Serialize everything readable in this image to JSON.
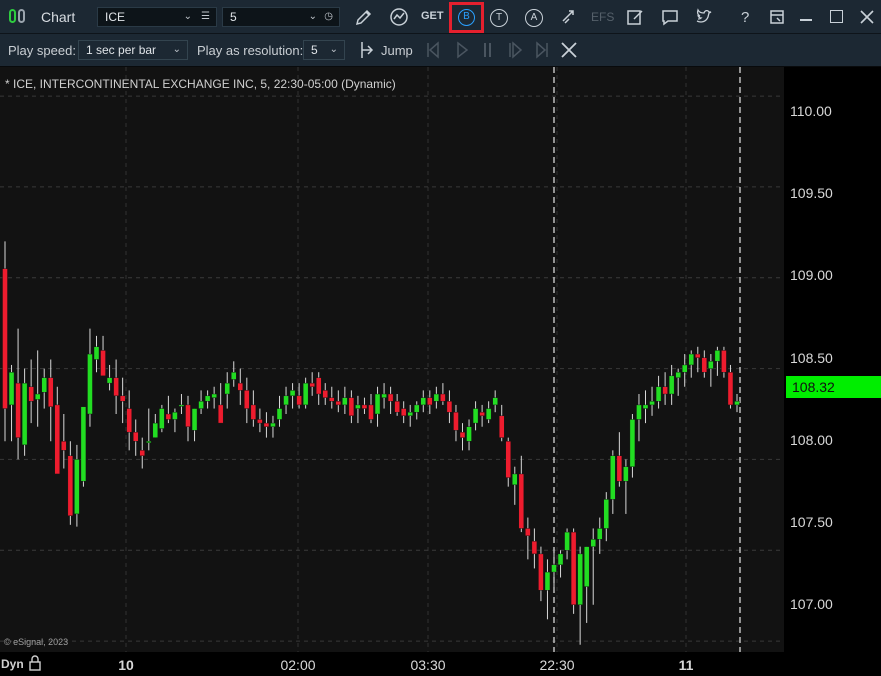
{
  "window": {
    "title": "Chart",
    "symbol": "ICE",
    "interval": "5",
    "get_label": "GET",
    "efs_label": "EFS"
  },
  "playback": {
    "speed_label": "Play speed:",
    "speed_value": "1 sec per bar",
    "resolution_label": "Play as resolution:",
    "resolution_value": "5",
    "jump_label": "Jump"
  },
  "chart": {
    "header": "* ICE, INTERCONTINENTAL EXCHANGE INC, 5, 22:30-05:00 (Dynamic)",
    "copyright": "© eSignal, 2023",
    "dyn_label": "Dyn",
    "last_price": "108.32"
  },
  "colors": {
    "up": "#22dd22",
    "down": "#ee1c2e",
    "last_price_bg": "#00ee00",
    "highlight": "#e5202e"
  },
  "y_axis": {
    "labels": [
      "110.00",
      "109.50",
      "109.00",
      "108.50",
      "108.00",
      "107.50",
      "107.00"
    ]
  },
  "x_axis": {
    "labels": [
      "10",
      "02:00",
      "03:30",
      "22:30",
      "11"
    ]
  },
  "chart_data": {
    "type": "candlestick",
    "title": "* ICE, INTERCONTINENTAL EXCHANGE INC, 5, 22:30-05:00 (Dynamic)",
    "ylim": [
      106.94,
      110.16
    ],
    "candles": [
      [
        109.05,
        109.2,
        108.1,
        108.28
      ],
      [
        108.3,
        108.52,
        108.1,
        108.48
      ],
      [
        108.42,
        108.72,
        108.0,
        108.12
      ],
      [
        108.08,
        108.5,
        108.02,
        108.42
      ],
      [
        108.4,
        108.55,
        108.2,
        108.32
      ],
      [
        108.33,
        108.6,
        108.18,
        108.36
      ],
      [
        108.37,
        108.5,
        108.28,
        108.45
      ],
      [
        108.45,
        108.55,
        108.1,
        108.29
      ],
      [
        108.3,
        108.4,
        107.95,
        107.92
      ],
      [
        108.1,
        108.25,
        107.95,
        108.05
      ],
      [
        108.02,
        108.1,
        107.64,
        107.69
      ],
      [
        107.7,
        108.08,
        107.63,
        108.0
      ],
      [
        107.88,
        108.28,
        107.85,
        108.29
      ],
      [
        108.25,
        108.72,
        108.18,
        108.58
      ],
      [
        108.55,
        108.68,
        108.48,
        108.62
      ],
      [
        108.6,
        108.68,
        108.48,
        108.46
      ],
      [
        108.42,
        108.52,
        108.38,
        108.45
      ],
      [
        108.45,
        108.55,
        108.25,
        108.35
      ],
      [
        108.35,
        108.45,
        108.2,
        108.32
      ],
      [
        108.28,
        108.38,
        108.05,
        108.15
      ],
      [
        108.15,
        108.22,
        108.02,
        108.1
      ],
      [
        108.05,
        108.12,
        107.95,
        108.02
      ],
      [
        108.1,
        108.28,
        108.05,
        108.1
      ],
      [
        108.12,
        108.25,
        108.12,
        108.2
      ],
      [
        108.17,
        108.3,
        108.15,
        108.28
      ],
      [
        108.25,
        108.35,
        108.2,
        108.22
      ],
      [
        108.22,
        108.28,
        108.15,
        108.26
      ],
      [
        108.3,
        108.36,
        108.25,
        108.3
      ],
      [
        108.3,
        108.35,
        108.1,
        108.18
      ],
      [
        108.16,
        108.28,
        108.1,
        108.28
      ],
      [
        108.28,
        108.38,
        108.25,
        108.32
      ],
      [
        108.32,
        108.38,
        108.28,
        108.35
      ],
      [
        108.34,
        108.4,
        108.28,
        108.36
      ],
      [
        108.3,
        108.42,
        108.25,
        108.2
      ],
      [
        108.36,
        108.48,
        108.28,
        108.42
      ],
      [
        108.44,
        108.54,
        108.4,
        108.48
      ],
      [
        108.42,
        108.5,
        108.3,
        108.38
      ],
      [
        108.38,
        108.45,
        108.2,
        108.28
      ],
      [
        108.3,
        108.38,
        108.18,
        108.22
      ],
      [
        108.22,
        108.28,
        108.15,
        108.2
      ],
      [
        108.2,
        108.26,
        108.12,
        108.18
      ],
      [
        108.18,
        108.24,
        108.12,
        108.2
      ],
      [
        108.22,
        108.35,
        108.18,
        108.28
      ],
      [
        108.3,
        108.4,
        108.25,
        108.35
      ],
      [
        108.35,
        108.42,
        108.28,
        108.38
      ],
      [
        108.35,
        108.42,
        108.28,
        108.3
      ],
      [
        108.3,
        108.45,
        108.28,
        108.42
      ],
      [
        108.42,
        108.48,
        108.35,
        108.4
      ],
      [
        108.45,
        108.48,
        108.3,
        108.36
      ],
      [
        108.38,
        108.42,
        108.3,
        108.34
      ],
      [
        108.34,
        108.4,
        108.28,
        108.32
      ],
      [
        108.32,
        108.38,
        108.26,
        108.3
      ],
      [
        108.3,
        108.4,
        108.25,
        108.34
      ],
      [
        108.34,
        108.38,
        108.2,
        108.24
      ],
      [
        108.28,
        108.35,
        108.2,
        108.3
      ],
      [
        108.3,
        108.34,
        108.25,
        108.28
      ],
      [
        108.3,
        108.36,
        108.2,
        108.22
      ],
      [
        108.25,
        108.4,
        108.18,
        108.36
      ],
      [
        108.34,
        108.42,
        108.28,
        108.36
      ],
      [
        108.36,
        108.4,
        108.25,
        108.32
      ],
      [
        108.32,
        108.36,
        108.24,
        108.26
      ],
      [
        108.28,
        108.32,
        108.2,
        108.24
      ],
      [
        108.24,
        108.3,
        108.18,
        108.26
      ],
      [
        108.26,
        108.32,
        108.22,
        108.3
      ],
      [
        108.3,
        108.38,
        108.26,
        108.34
      ],
      [
        108.34,
        108.38,
        108.25,
        108.3
      ],
      [
        108.32,
        108.4,
        108.28,
        108.36
      ],
      [
        108.36,
        108.42,
        108.3,
        108.32
      ],
      [
        108.32,
        108.38,
        108.2,
        108.26
      ],
      [
        108.26,
        108.3,
        108.1,
        108.16
      ],
      [
        108.15,
        108.2,
        108.05,
        108.12
      ],
      [
        108.1,
        108.22,
        108.05,
        108.18
      ],
      [
        108.2,
        108.32,
        108.16,
        108.28
      ],
      [
        108.26,
        108.3,
        108.18,
        108.24
      ],
      [
        108.22,
        108.32,
        108.2,
        108.28
      ],
      [
        108.3,
        108.38,
        108.26,
        108.34
      ],
      [
        108.24,
        108.3,
        108.1,
        108.12
      ],
      [
        108.1,
        108.12,
        107.85,
        107.9
      ],
      [
        107.86,
        107.96,
        107.75,
        107.92
      ],
      [
        107.92,
        108.02,
        107.6,
        107.62
      ],
      [
        107.62,
        107.68,
        107.45,
        107.58
      ],
      [
        107.55,
        107.62,
        107.4,
        107.48
      ],
      [
        107.48,
        107.52,
        107.22,
        107.28
      ],
      [
        107.28,
        107.45,
        107.12,
        107.38
      ],
      [
        107.38,
        107.5,
        107.28,
        107.42
      ],
      [
        107.42,
        107.5,
        107.35,
        107.48
      ],
      [
        107.5,
        107.62,
        107.45,
        107.6
      ],
      [
        107.6,
        107.62,
        107.15,
        107.2
      ],
      [
        107.2,
        107.52,
        106.98,
        107.48
      ],
      [
        107.3,
        107.52,
        107.1,
        107.52
      ],
      [
        107.52,
        107.62,
        107.2,
        107.56
      ],
      [
        107.56,
        107.68,
        107.48,
        107.62
      ],
      [
        107.62,
        107.82,
        107.55,
        107.78
      ],
      [
        107.78,
        108.05,
        107.7,
        108.02
      ],
      [
        108.02,
        108.15,
        107.85,
        107.88
      ],
      [
        107.88,
        108.0,
        107.7,
        107.96
      ],
      [
        107.96,
        108.25,
        107.9,
        108.22
      ],
      [
        108.22,
        108.36,
        108.1,
        108.3
      ],
      [
        108.28,
        108.38,
        108.2,
        108.3
      ],
      [
        108.3,
        108.4,
        108.24,
        108.32
      ],
      [
        108.32,
        108.46,
        108.28,
        108.4
      ],
      [
        108.4,
        108.48,
        108.3,
        108.36
      ],
      [
        108.36,
        108.52,
        108.3,
        108.46
      ],
      [
        108.45,
        108.5,
        108.35,
        108.48
      ],
      [
        108.48,
        108.58,
        108.4,
        108.52
      ],
      [
        108.52,
        108.6,
        108.45,
        108.58
      ],
      [
        108.58,
        108.62,
        108.48,
        108.56
      ],
      [
        108.56,
        108.6,
        108.45,
        108.48
      ],
      [
        108.5,
        108.58,
        108.4,
        108.54
      ],
      [
        108.54,
        108.62,
        108.46,
        108.6
      ],
      [
        108.6,
        108.62,
        108.45,
        108.48
      ],
      [
        108.48,
        108.52,
        108.28,
        108.3
      ],
      [
        108.3,
        108.36,
        108.26,
        108.32
      ]
    ]
  }
}
